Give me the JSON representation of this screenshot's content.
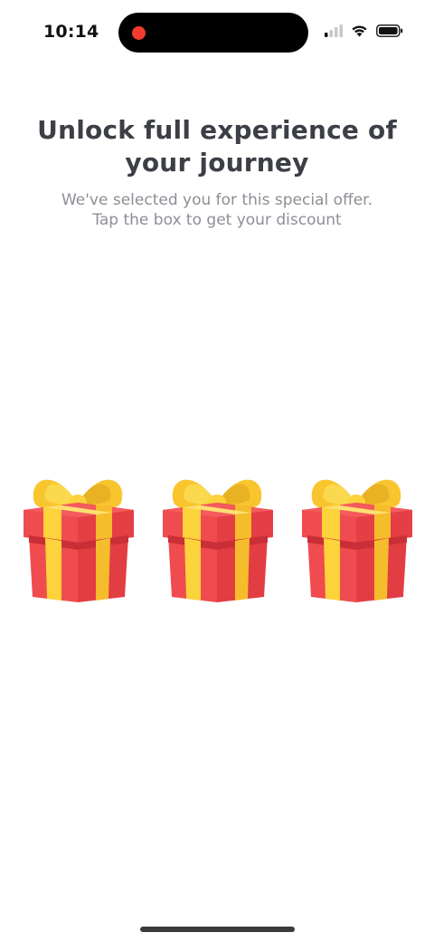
{
  "status_bar": {
    "time": "10:14",
    "icons": [
      "signal-icon",
      "wifi-icon",
      "battery-icon"
    ],
    "recording_color": "#f23c2f"
  },
  "offer": {
    "title": "Unlock full experience of your journey",
    "subtitle_line1": "We've selected you for this special offer.",
    "subtitle_line2": "Tap the box to get your discount"
  },
  "gifts": {
    "count": 3,
    "icon": "gift-box-icon",
    "colors": {
      "box": "#f04b4f",
      "box_dark": "#d83a3f",
      "ribbon": "#fcd33b",
      "bow": "#f9c52e"
    }
  },
  "colors": {
    "title": "#3d3f47",
    "subtitle": "#8c8e96",
    "background": "#ffffff"
  }
}
